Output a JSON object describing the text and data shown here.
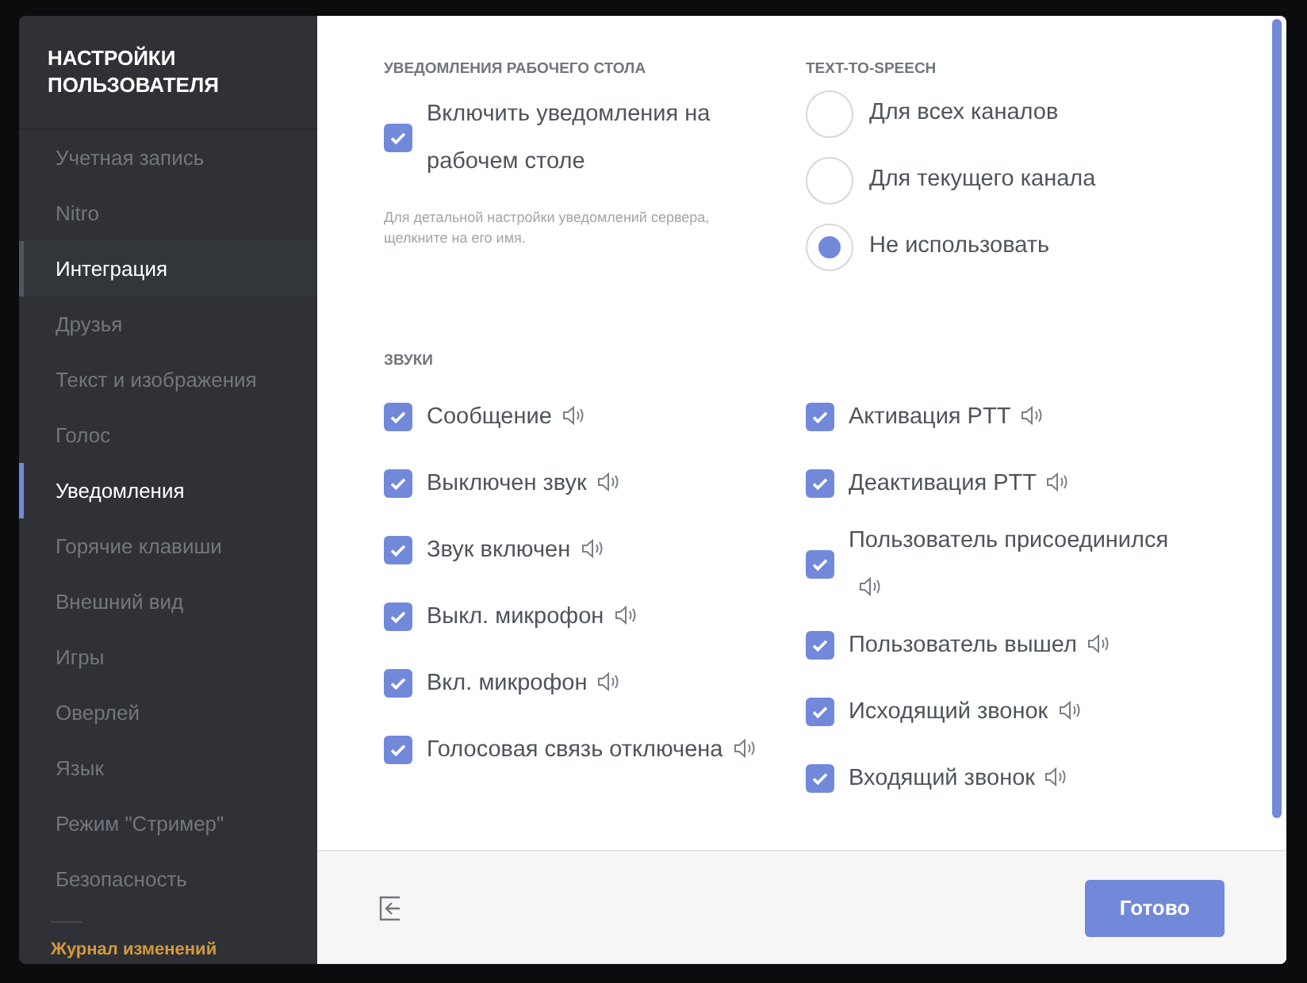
{
  "sidebar": {
    "title": "НАСТРОЙКИ ПОЛЬЗОВАТЕЛЯ",
    "items": [
      {
        "label": "Учетная запись",
        "selected": false,
        "hovered": false
      },
      {
        "label": "Nitro",
        "selected": false,
        "hovered": false
      },
      {
        "label": "Интеграция",
        "selected": false,
        "hovered": true
      },
      {
        "label": "Друзья",
        "selected": false,
        "hovered": false
      },
      {
        "label": "Текст и изображения",
        "selected": false,
        "hovered": false
      },
      {
        "label": "Голос",
        "selected": false,
        "hovered": false
      },
      {
        "label": "Уведомления",
        "selected": true,
        "hovered": false
      },
      {
        "label": "Горячие клавиши",
        "selected": false,
        "hovered": false
      },
      {
        "label": "Внешний вид",
        "selected": false,
        "hovered": false
      },
      {
        "label": "Игры",
        "selected": false,
        "hovered": false
      },
      {
        "label": "Оверлей",
        "selected": false,
        "hovered": false
      },
      {
        "label": "Язык",
        "selected": false,
        "hovered": false
      },
      {
        "label": "Режим \"Стример\"",
        "selected": false,
        "hovered": false
      },
      {
        "label": "Безопасность",
        "selected": false,
        "hovered": false
      }
    ],
    "changelog": "Журнал изменений"
  },
  "desktop_notifications": {
    "heading": "УВЕДОМЛЕНИЯ РАБОЧЕГО СТОЛА",
    "checkbox": {
      "label": "Включить уведомления на рабочем столе",
      "checked": true
    },
    "hint": "Для детальной настройки уведомлений сервера, щелкните на его имя."
  },
  "tts": {
    "heading": "TEXT-TO-SPEECH",
    "options": [
      {
        "label": "Для всех каналов",
        "selected": false
      },
      {
        "label": "Для текущего канала",
        "selected": false
      },
      {
        "label": "Не использовать",
        "selected": true
      }
    ]
  },
  "sounds": {
    "heading": "ЗВУКИ",
    "left": [
      {
        "label": "Сообщение",
        "checked": true
      },
      {
        "label": "Выключен звук",
        "checked": true
      },
      {
        "label": "Звук включен",
        "checked": true
      },
      {
        "label": "Выкл. микрофон",
        "checked": true
      },
      {
        "label": "Вкл. микрофон",
        "checked": true
      },
      {
        "label": "Голосовая связь отключена",
        "checked": true
      }
    ],
    "right": [
      {
        "label": "Активация PTT",
        "checked": true
      },
      {
        "label": "Деактивация PTT",
        "checked": true
      },
      {
        "label": "Пользователь присоединился",
        "checked": true
      },
      {
        "label": "Пользователь вышел",
        "checked": true
      },
      {
        "label": "Исходящий звонок",
        "checked": true
      },
      {
        "label": "Входящий звонок",
        "checked": true
      }
    ]
  },
  "footer": {
    "done_button": "Готово"
  }
}
